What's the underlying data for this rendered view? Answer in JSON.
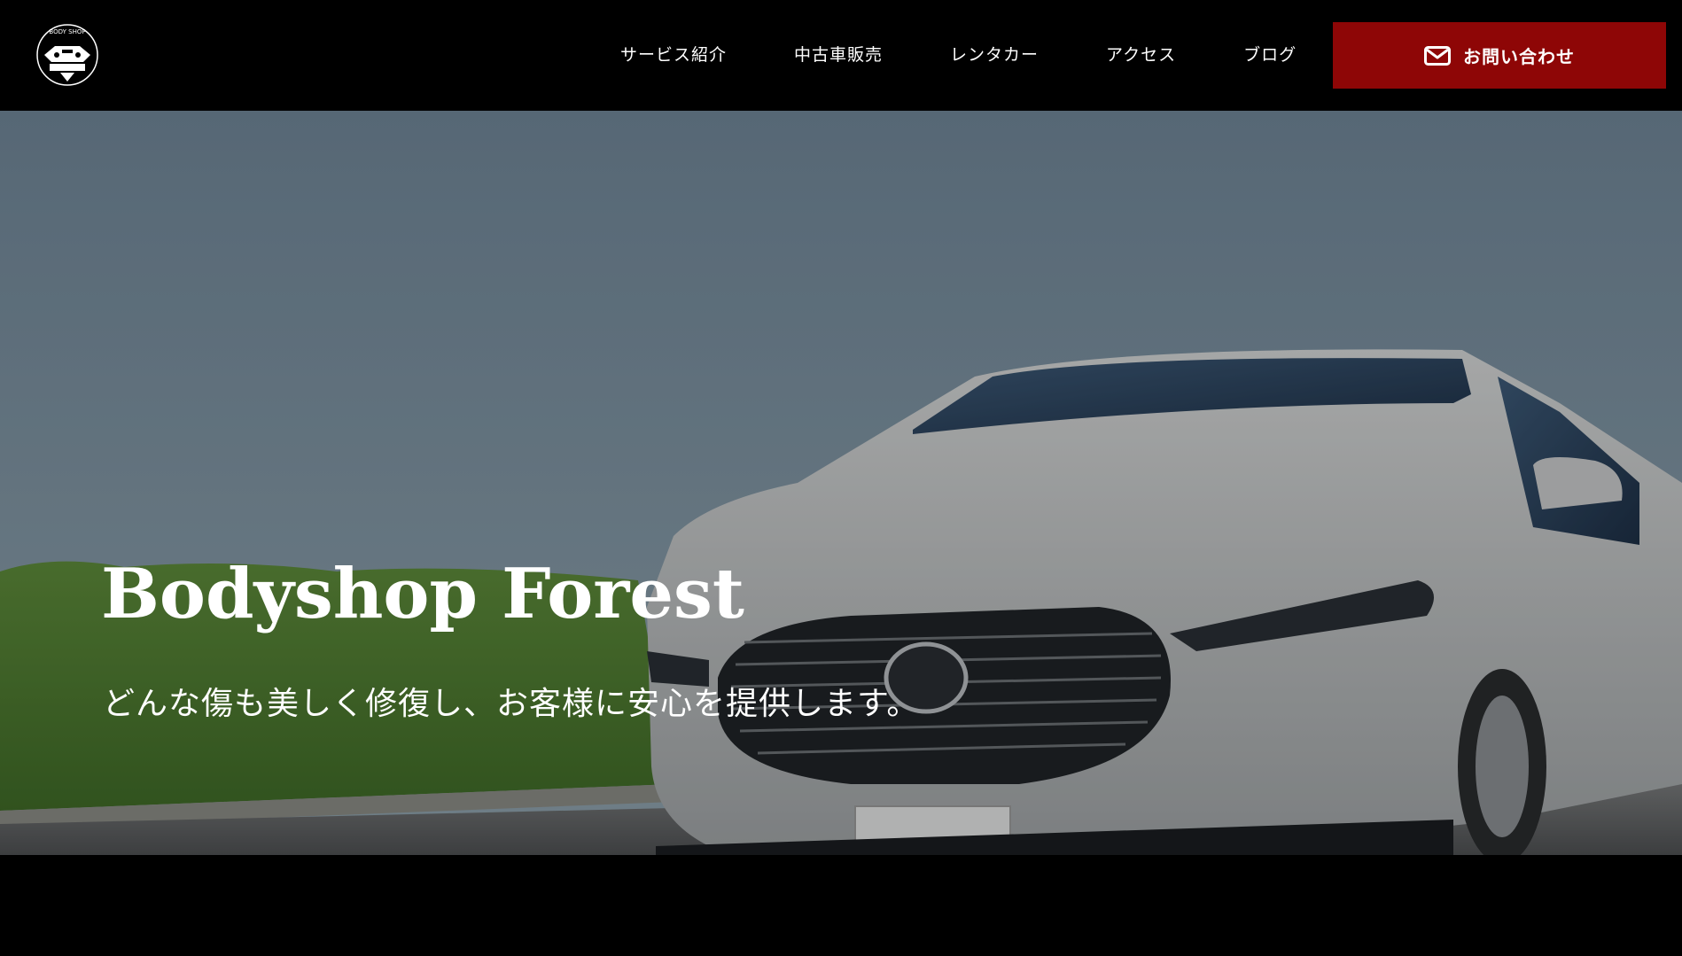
{
  "header": {
    "logo_icon": "bodyshop-logo-icon",
    "logo_text": "BODY SHOP",
    "nav": [
      {
        "label": "サービス紹介"
      },
      {
        "label": "中古車販売"
      },
      {
        "label": "レンタカー"
      },
      {
        "label": "アクセス"
      },
      {
        "label": "ブログ"
      }
    ],
    "contact": {
      "icon": "mail-icon",
      "label": "お問い合わせ",
      "color": "#8e0606"
    }
  },
  "hero": {
    "title": "Bodyshop Forest",
    "subtitle": "どんな傷も美しく修復し、お客様に安心を提供します。",
    "image": "white-suv-on-road-photo"
  }
}
